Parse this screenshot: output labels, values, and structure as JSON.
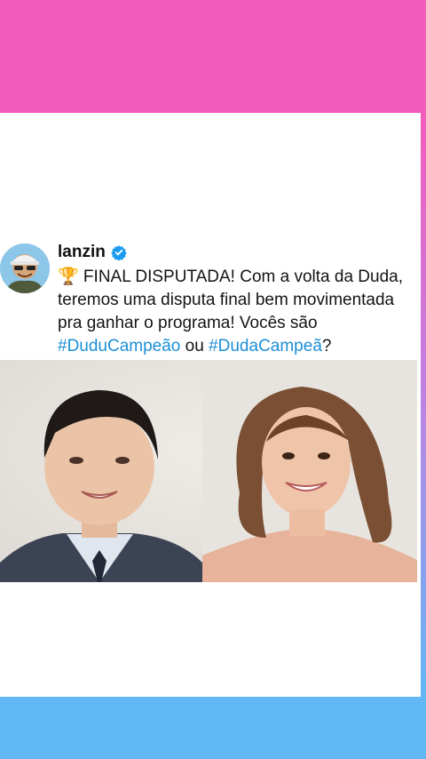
{
  "post": {
    "username": "lanzin",
    "text_before": "🏆 FINAL DISPUTADA! Com a volta da Duda, teremos uma disputa final bem movimentada pra ganhar o programa! Vocês são ",
    "hashtag1": "#DuduCampeão",
    "connector": " ou ",
    "hashtag2": "#DudaCampeã",
    "text_after": "?"
  },
  "colors": {
    "top_band": "#f35cbc",
    "bottom_band": "#62b7f5",
    "hashtag": "#1d8fd6",
    "verified": "#1d9bf0"
  },
  "icons": {
    "verified": "verified-badge-icon"
  }
}
